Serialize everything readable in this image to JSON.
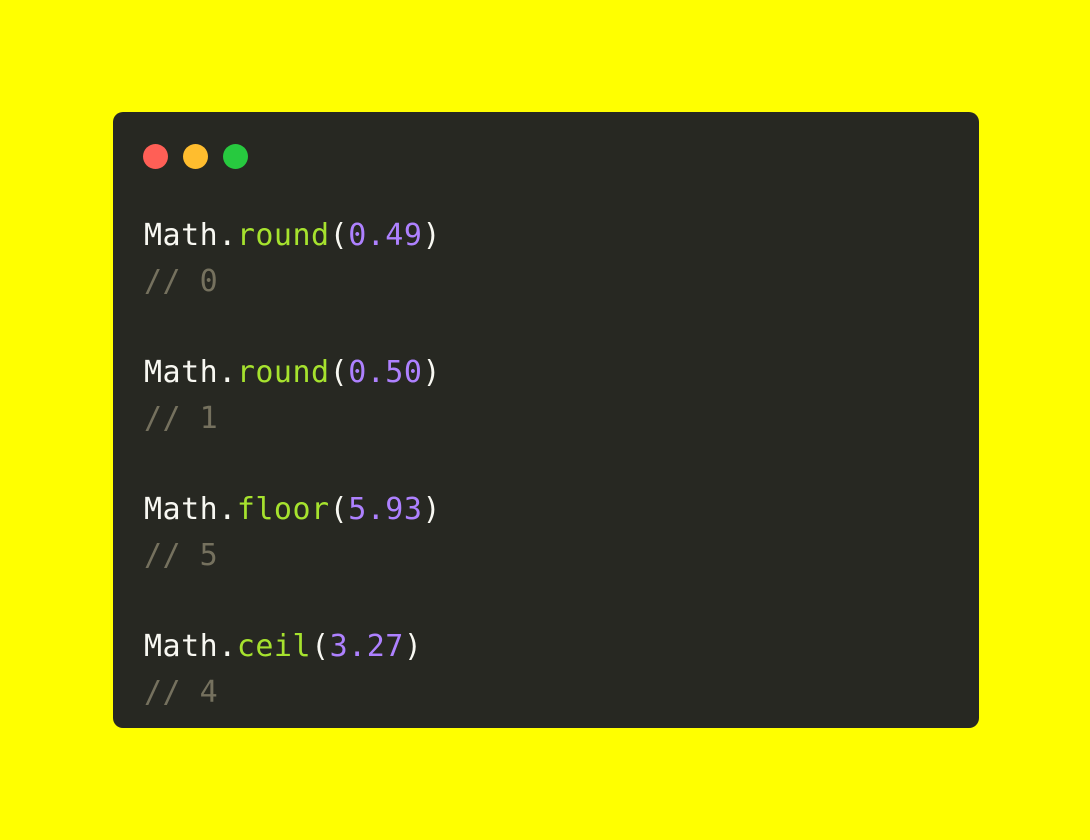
{
  "colors": {
    "page_background": "#ffff00",
    "window_background": "#272822",
    "text_default": "#f8f8f2",
    "function": "#a6e22e",
    "number": "#ae81ff",
    "comment": "#75715e",
    "dot_close": "#ff5f56",
    "dot_minimize": "#ffbd2e",
    "dot_maximize": "#27c93f"
  },
  "window": {
    "buttons": [
      {
        "name": "close",
        "color": "#ff5f56"
      },
      {
        "name": "minimize",
        "color": "#ffbd2e"
      },
      {
        "name": "maximize",
        "color": "#27c93f"
      }
    ]
  },
  "code": {
    "blocks": [
      {
        "object": "Math",
        "dot": ".",
        "method": "round",
        "open": "(",
        "arg": "0.49",
        "close": ")",
        "comment": "// 0"
      },
      {
        "object": "Math",
        "dot": ".",
        "method": "round",
        "open": "(",
        "arg": "0.50",
        "close": ")",
        "comment": "// 1"
      },
      {
        "object": "Math",
        "dot": ".",
        "method": "floor",
        "open": "(",
        "arg": "5.93",
        "close": ")",
        "comment": "// 5"
      },
      {
        "object": "Math",
        "dot": ".",
        "method": "ceil",
        "open": "(",
        "arg": "3.27",
        "close": ")",
        "comment": "// 4"
      }
    ]
  }
}
